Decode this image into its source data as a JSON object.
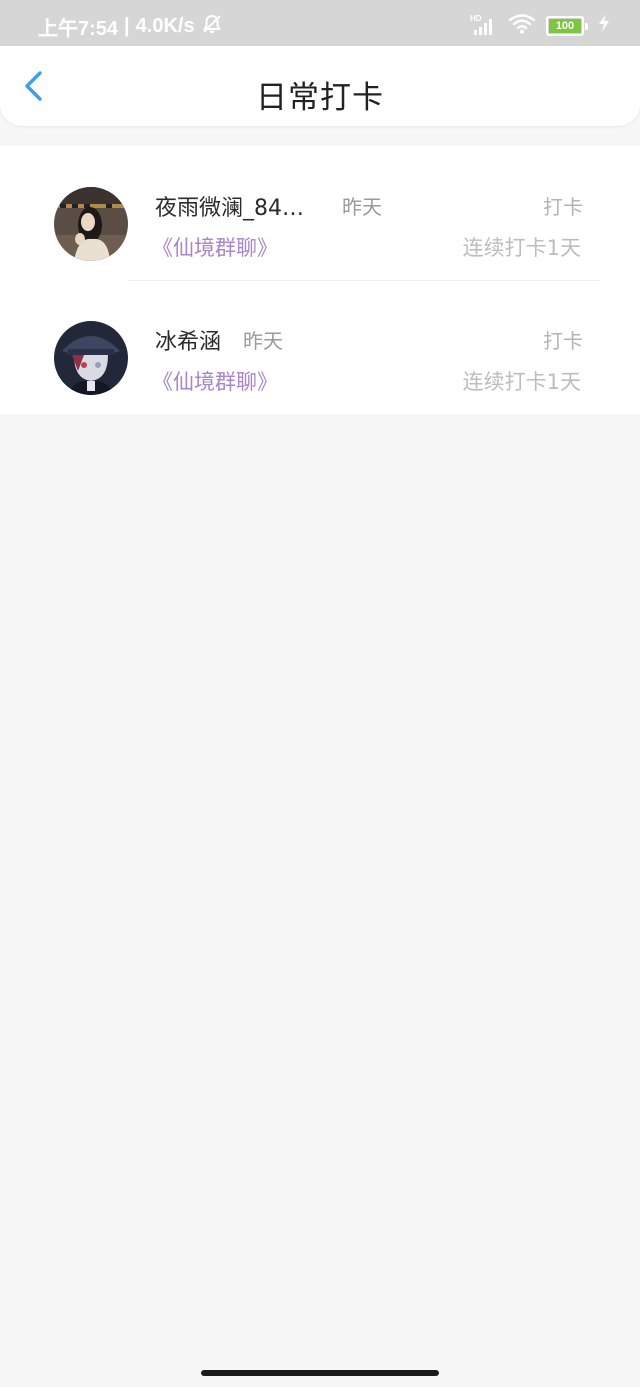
{
  "status_bar": {
    "time": "上午7:54",
    "separator": "|",
    "network_speed": "4.0K/s",
    "signal_tag": "HD",
    "battery_level": "100",
    "icons": [
      "bell-off-icon",
      "signal-icon",
      "wifi-icon",
      "battery-icon",
      "charging-icon"
    ]
  },
  "header": {
    "title": "日常打卡",
    "back_icon": "chevron-left-icon",
    "accent_color": "#3ba0e6"
  },
  "checkins": [
    {
      "name": "夜雨微澜_84…",
      "time": "昨天",
      "action": "打卡",
      "group": "《仙境群聊》",
      "streak": "连续打卡1天"
    },
    {
      "name": "冰希涵",
      "time": "昨天",
      "action": "打卡",
      "group": "《仙境群聊》",
      "streak": "连续打卡1天"
    }
  ],
  "colors": {
    "status_bar_bg": "#d6d6d6",
    "page_bg": "#f8f7f8",
    "group_link": "#a885cc",
    "battery_fill": "#7ec544"
  }
}
